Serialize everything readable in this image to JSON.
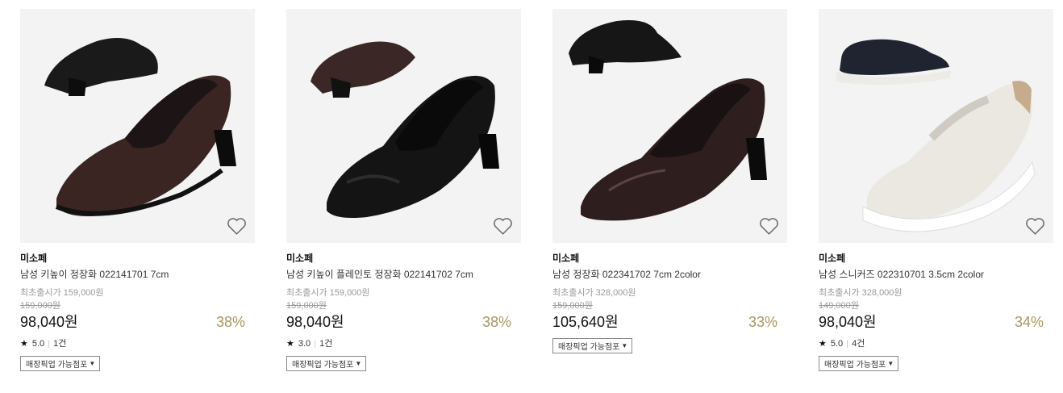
{
  "products": [
    {
      "brand": "미소페",
      "name": "남성 키높이 정장화 022141701 7cm",
      "orig_label": "최초출시가 159,000원",
      "strike_price": "159,000원",
      "price": "98,040원",
      "discount": "38%",
      "rating": "5.0",
      "review_count": "1건",
      "pickup_label": "매장픽업 가능점포"
    },
    {
      "brand": "미소페",
      "name": "남성 키높이 플레인토 정장화 022141702 7cm",
      "orig_label": "최초출시가 159,000원",
      "strike_price": "159,000원",
      "price": "98,040원",
      "discount": "38%",
      "rating": "3.0",
      "review_count": "1건",
      "pickup_label": "매장픽업 가능점포"
    },
    {
      "brand": "미소페",
      "name": "남성 정장화 022341702 7cm 2color",
      "orig_label": "최초출시가 328,000원",
      "strike_price": "159,000원",
      "price": "105,640원",
      "discount": "33%",
      "pickup_label": "매장픽업 가능점포"
    },
    {
      "brand": "미소페",
      "name": "남성 스니커즈 022310701 3.5cm 2color",
      "orig_label": "최초출시가 328,000원",
      "strike_price": "149,000원",
      "price": "98,040원",
      "discount": "34%",
      "rating": "5.0",
      "review_count": "4건",
      "pickup_label": "매장픽업 가능점포"
    }
  ],
  "icons": {
    "heart": "heart-icon",
    "star": "star-icon",
    "dropdown": "triangle-down-icon"
  },
  "colors": {
    "discount": "#a8955f",
    "image_bg": "#f3f3f3"
  }
}
